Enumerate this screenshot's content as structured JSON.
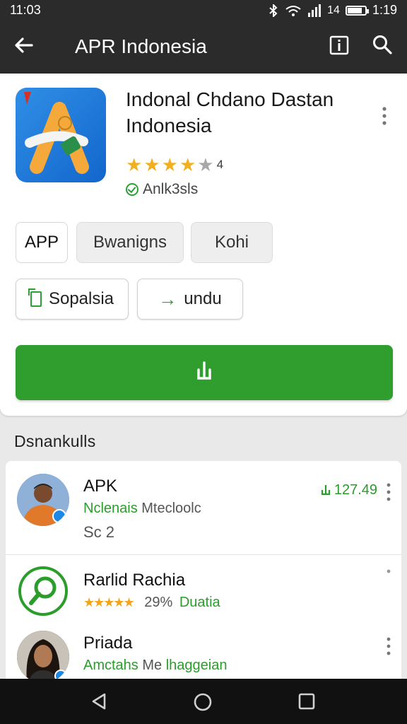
{
  "status_bar": {
    "time_left": "11:03",
    "signal_text": "14",
    "time_right": "1:19",
    "battery_level": 0.85
  },
  "toolbar": {
    "title": "APR Indonesia",
    "back_icon": "arrow-left-icon",
    "info_icon": "info-icon",
    "search_icon": "search-icon"
  },
  "app": {
    "name": "Indonal Chdano Dastan Indonesia",
    "rating_stars": 4.5,
    "rating_value": "4",
    "verified_label": "Anlk3sls"
  },
  "chips": {
    "type": "APP",
    "category": "Bwanigns",
    "tag": "Kohi"
  },
  "buttons": {
    "share": "Sopalsia",
    "open": "undu",
    "install_icon": "download-icon"
  },
  "section": {
    "title": "Dsnankulls"
  },
  "list": [
    {
      "title": "APK",
      "subtitle_green": "Nclenais",
      "subtitle_gray": " Mtecloolc",
      "extra": "Sc 2",
      "count": "127.49"
    },
    {
      "title": "Rarlid Rachia",
      "stars": "★★★★★",
      "rating": "29%",
      "subtitle_green": "Duatia"
    },
    {
      "title": "Priada",
      "subtitle_green": "Amctahs",
      "subtitle_gray": " Me ",
      "subtitle_green2": "lhaggeian"
    }
  ],
  "colors": {
    "accent_green": "#2f9e2f",
    "toolbar": "#2b2b2b",
    "star": "#f2b01e"
  }
}
